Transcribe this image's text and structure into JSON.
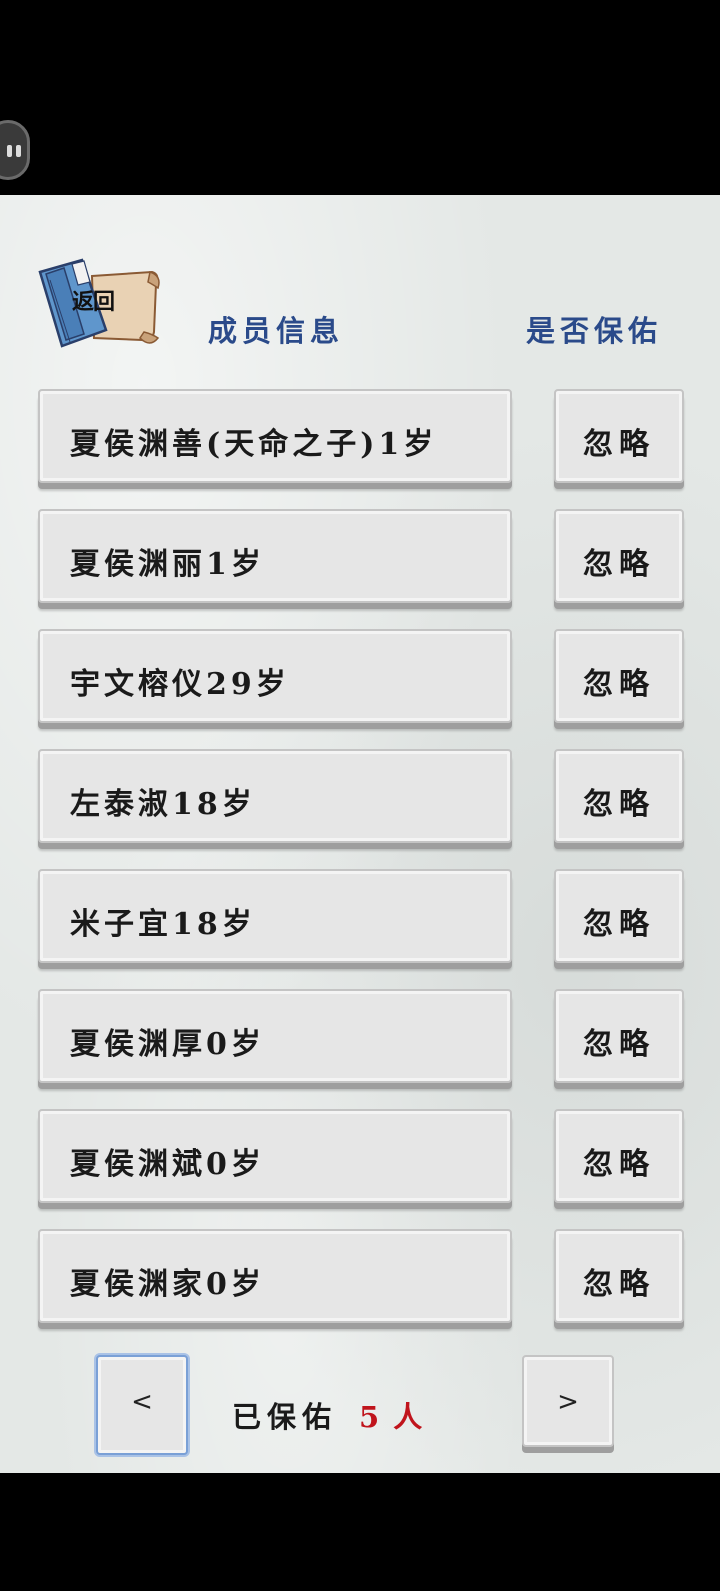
{
  "header": {
    "back_label": "返回",
    "col_member": "成员信息",
    "col_protect": "是否保佑"
  },
  "members": [
    {
      "name": "夏侯渊善(天命之子)1岁",
      "action": "忽略"
    },
    {
      "name": "夏侯渊丽1岁",
      "action": "忽略"
    },
    {
      "name": "宇文榕仪29岁",
      "action": "忽略"
    },
    {
      "name": "左泰淑18岁",
      "action": "忽略"
    },
    {
      "name": "米子宜18岁",
      "action": "忽略"
    },
    {
      "name": "夏侯渊厚0岁",
      "action": "忽略"
    },
    {
      "name": "夏侯渊斌0岁",
      "action": "忽略"
    },
    {
      "name": "夏侯渊家0岁",
      "action": "忽略"
    }
  ],
  "footer": {
    "prev_label": "<",
    "next_label": ">",
    "protected_label": "已保佑",
    "protected_count": "5",
    "protected_unit": "人"
  },
  "colors": {
    "header_text": "#2a4a8a",
    "count_text": "#c0141c"
  }
}
